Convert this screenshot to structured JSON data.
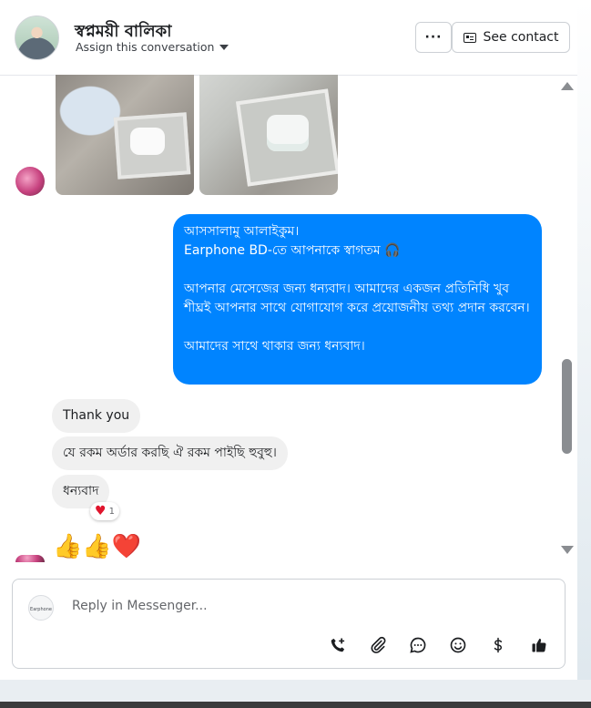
{
  "header": {
    "contact_name": "স্বপ্নময়ী বালিকা",
    "assign_label": "Assign this conversation",
    "more_label": "···",
    "see_contact_label": "See contact"
  },
  "messages": {
    "outgoing": "আসসালামু আলাইকুম।\nEarphone BD-তে আপনাকে স্বাগতম 🎧\n\nআপনার মেসেজের জন্য ধন্যবাদ। আমাদের একজন প্রতিনিধি খুব শীঘ্রই আপনার সাথে যোগাযোগ করে প্রয়োজনীয় তথ্য প্রদান করবেন।\n\nআমাদের সাথে থাকার জন্য ধন্যবাদ।",
    "incoming": [
      "Thank you",
      "যে রকম অর্ডার করছি ঐ রকম পাইছি হুবুহু।",
      "ধন্যবাদ"
    ],
    "reaction_count": "1",
    "emoji_line": "👍👍❤️"
  },
  "composer": {
    "placeholder": "Reply in Messenger...",
    "page_logo_text": "Earphone BD"
  },
  "icons": [
    "chevron-down-icon",
    "id-card-icon",
    "call-add-icon",
    "paperclip-icon",
    "saved-reply-icon",
    "emoji-icon",
    "dollar-icon",
    "thumbs-up-icon"
  ]
}
